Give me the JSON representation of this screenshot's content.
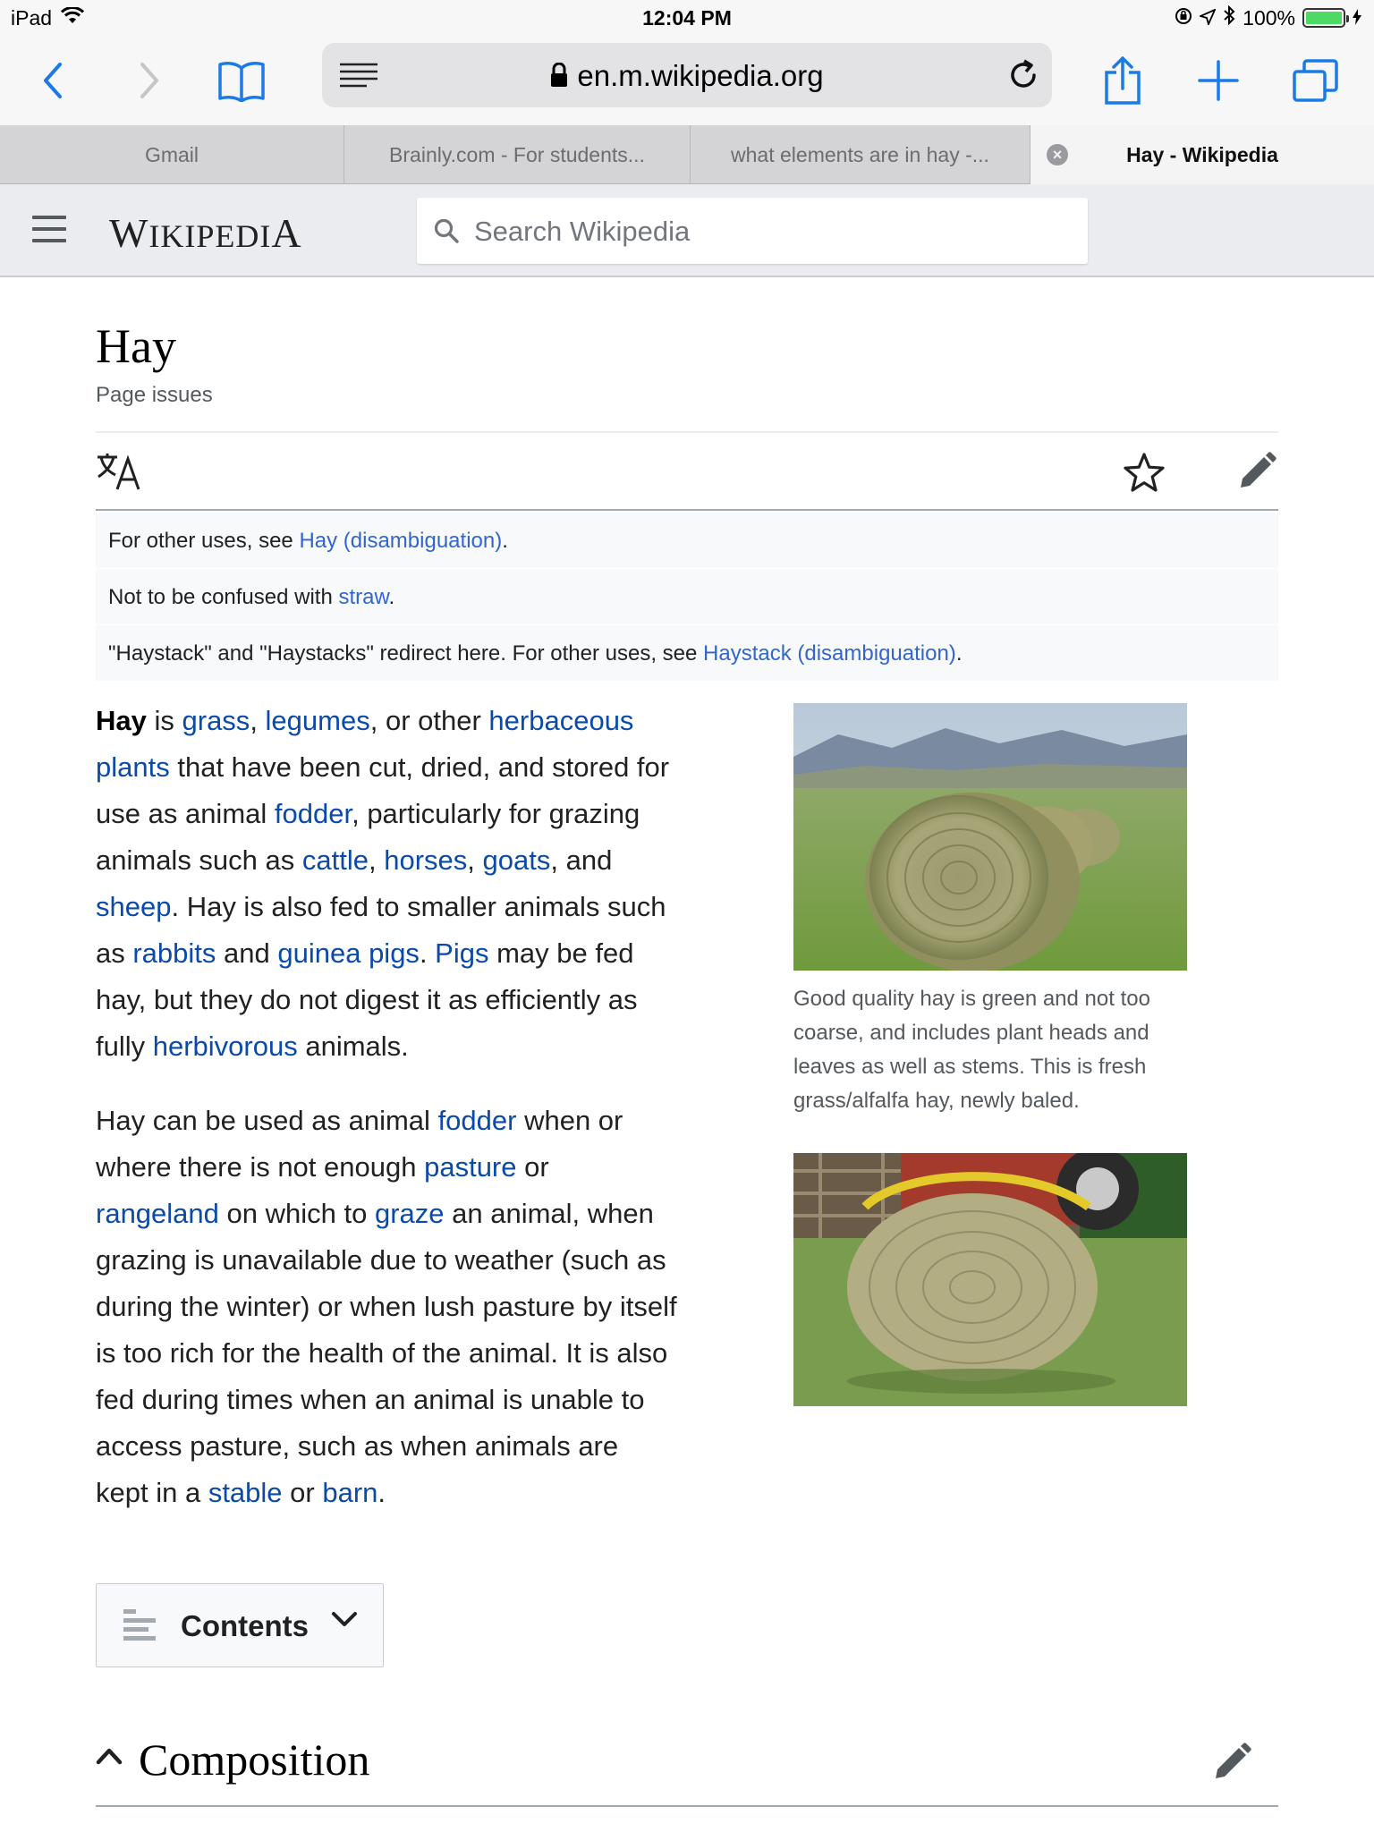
{
  "status_bar": {
    "device": "iPad",
    "time": "12:04 PM",
    "battery": "100%",
    "battery_level": 1.0
  },
  "browser": {
    "url": "en.m.wikipedia.org",
    "icons": [
      "back-icon",
      "forward-icon",
      "bookmarks-icon",
      "reader-icon",
      "lock-icon",
      "reload-icon",
      "share-icon",
      "new-tab-icon",
      "tabs-icon"
    ],
    "accent": "#1a7ae6",
    "tabs": [
      {
        "label": "Gmail"
      },
      {
        "label": "Brainly.com - For students..."
      },
      {
        "label": "what elements are in hay -..."
      },
      {
        "label": "Hay - Wikipedia"
      }
    ]
  },
  "wiki_header": {
    "wordmark_first": "W",
    "wordmark_rest": "IKIPEDI",
    "wordmark_last": "A",
    "search_placeholder": "Search Wikipedia"
  },
  "article": {
    "title": "Hay",
    "page_issues": "Page issues",
    "hatnotes": {
      "h1_pre": "For other uses, see ",
      "h1_link": "Hay (disambiguation)",
      "h1_post": ".",
      "h2_pre": "Not to be confused with ",
      "h2_link": "straw",
      "h2_post": ".",
      "h3_pre": "\"Haystack\" and \"Haystacks\" redirect here. For other uses, see ",
      "h3_link": "Haystack (disambiguation)",
      "h3_post": "."
    },
    "p1": {
      "t0": "Hay",
      "t1": " is ",
      "l1": "grass",
      "t2": ", ",
      "l2": "legumes",
      "t3": ", or other ",
      "l3": "herbaceous plants",
      "t4": " that have been cut, dried, and stored for use as animal ",
      "l4": "fodder",
      "t5": ", particularly for grazing animals such as ",
      "l5": "cattle",
      "t6": ", ",
      "l6": "horses",
      "t7": ", ",
      "l7": "goats",
      "t8": ", and ",
      "l8": "sheep",
      "t9": ". Hay is also fed to smaller animals such as ",
      "l9": "rabbits",
      "t10": " and ",
      "l10": "guinea pigs",
      "t11": ". ",
      "l11": "Pigs",
      "t12": " may be fed hay, but they do not digest it as efficiently as fully ",
      "l12": "herbivorous",
      "t13": " animals."
    },
    "p2": {
      "t0": "Hay can be used as animal ",
      "l1": "fodder",
      "t1": " when or where there is not enough ",
      "l2": "pasture",
      "t2": " or ",
      "l3": "rangeland",
      "t3": " on which to ",
      "l4": "graze",
      "t4": " an animal, when grazing is unavailable due to weather (such as during the winter) or when lush pasture by itself is too rich for the health of the animal. It is also fed during times when an animal is unable to access pasture, such as when animals are kept in a ",
      "l5": "stable",
      "t5": " or ",
      "l6": "barn",
      "t6": "."
    },
    "image1_caption": "Good quality hay is green and not too coarse, and includes plant heads and leaves as well as stems. This is fresh grass/alfalfa hay, newly baled.",
    "contents_label": "Contents",
    "section_title": "Composition"
  },
  "colors": {
    "link": "#3366cc",
    "link_body": "#0b4aa8",
    "header_bg": "#eaecf0"
  }
}
